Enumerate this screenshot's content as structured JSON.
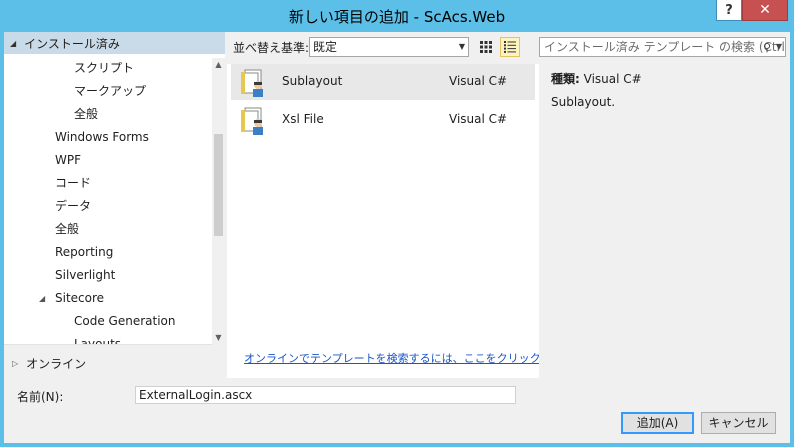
{
  "window": {
    "title": "新しい項目の追加 - ScAcs.Web",
    "help_label": "?",
    "close_label": "✕"
  },
  "left": {
    "installed_header": "インストール済み",
    "tree": [
      {
        "label": "スクリプト",
        "indent": 2
      },
      {
        "label": "マークアップ",
        "indent": 2
      },
      {
        "label": "全般",
        "indent": 2
      },
      {
        "label": "Windows Forms",
        "indent": 1
      },
      {
        "label": "WPF",
        "indent": 1
      },
      {
        "label": "コード",
        "indent": 1
      },
      {
        "label": "データ",
        "indent": 1
      },
      {
        "label": "全般",
        "indent": 1
      },
      {
        "label": "Reporting",
        "indent": 1
      },
      {
        "label": "Silverlight",
        "indent": 1
      },
      {
        "label": "Sitecore",
        "indent": 1,
        "expanded": true
      },
      {
        "label": "Code Generation",
        "indent": 2
      },
      {
        "label": "Layouts",
        "indent": 2
      }
    ],
    "online_label": "オンライン"
  },
  "toolbar": {
    "sort_label": "並べ替え基準:",
    "sort_value": "既定",
    "search_placeholder": "インストール済み テンプレート の検索 (Ctrl+E)"
  },
  "templates": [
    {
      "name": "Sublayout",
      "language": "Visual C#",
      "selected": true
    },
    {
      "name": "Xsl File",
      "language": "Visual C#",
      "selected": false
    }
  ],
  "online_search_link": "オンラインでテンプレートを検索するには、ここをクリックします。",
  "detail": {
    "type_label": "種類:",
    "type_value": "Visual C#",
    "description": "Sublayout."
  },
  "footer": {
    "name_label": "名前(N):",
    "name_value": "ExternalLogin.ascx",
    "add_label": "追加(A)",
    "cancel_label": "キャンセル"
  },
  "colors": {
    "title_bar": "#5bbfe8",
    "close_button": "#c75050",
    "tree_header": "#c9dbe8",
    "link": "#1a56c4",
    "selected_row": "#e8e8e8"
  }
}
